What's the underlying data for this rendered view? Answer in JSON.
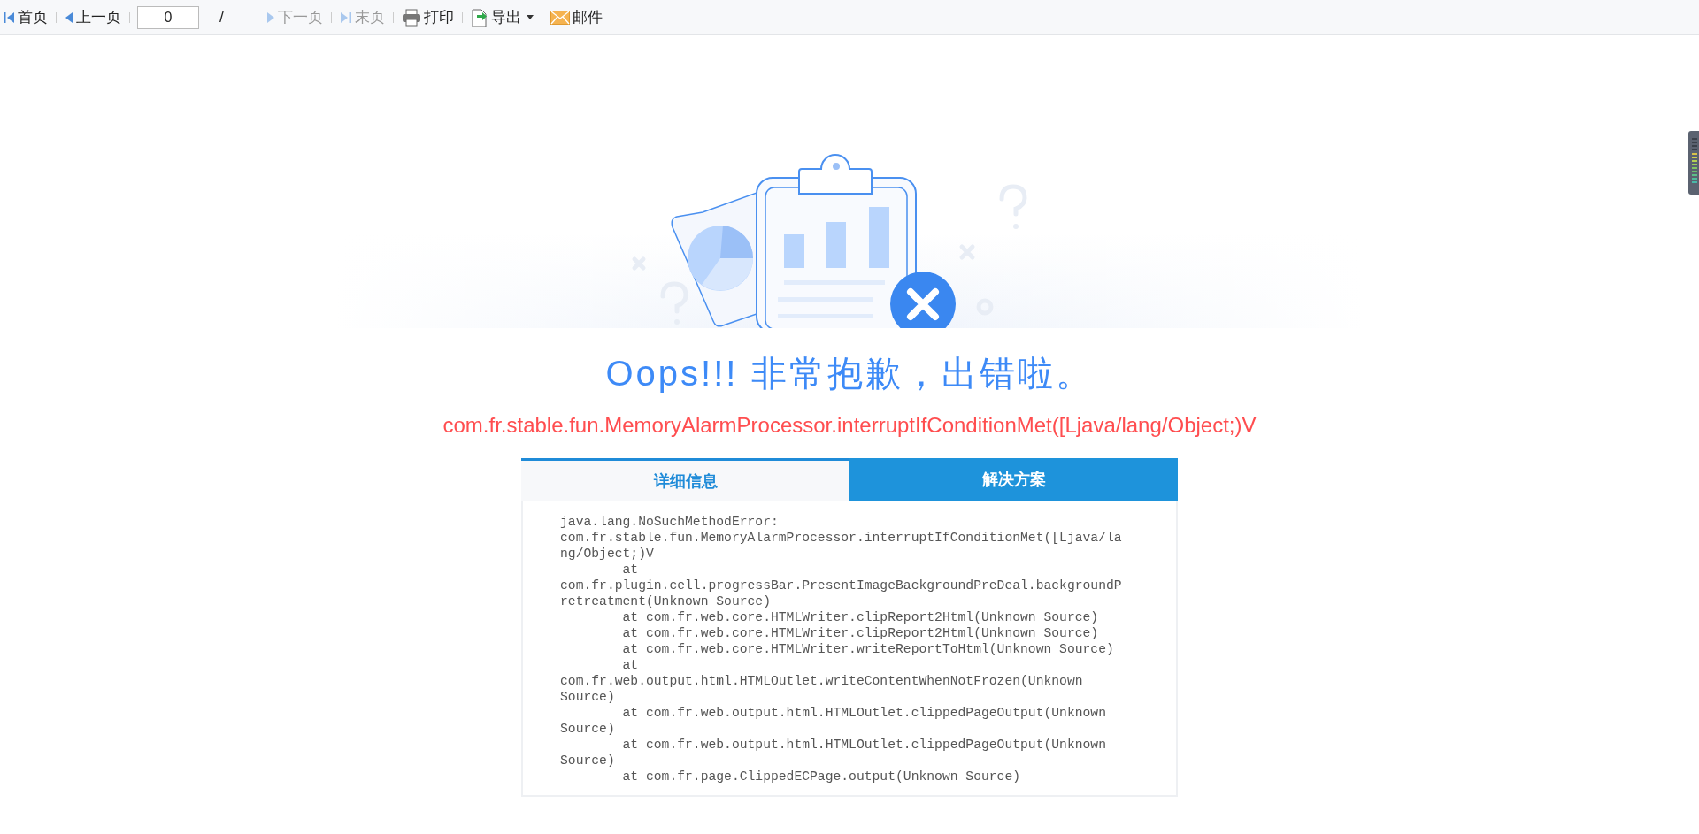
{
  "toolbar": {
    "items": [
      {
        "kind": "button",
        "label": "首页",
        "disabled": false
      },
      {
        "kind": "button",
        "label": "上一页",
        "disabled": false
      },
      {
        "kind": "page",
        "value": "0",
        "separator": "/"
      },
      {
        "kind": "button",
        "label": "下一页",
        "disabled": true
      },
      {
        "kind": "button",
        "label": "末页",
        "disabled": true
      },
      {
        "kind": "button",
        "label": "打印",
        "disabled": false
      },
      {
        "kind": "dropdown",
        "label": "导出",
        "disabled": false
      },
      {
        "kind": "button",
        "label": "邮件",
        "disabled": false
      }
    ]
  },
  "error": {
    "heading": "Oops!!! 非常抱歉，出错啦。",
    "message": "com.fr.stable.fun.MemoryAlarmProcessor.interruptIfConditionMet([Ljava/lang/Object;)V"
  },
  "tabs": [
    {
      "label": "详细信息",
      "selected": true
    },
    {
      "label": "解决方案",
      "selected": false
    }
  ],
  "details": {
    "lines": [
      "java.lang.NoSuchMethodError:",
      "com.fr.stable.fun.MemoryAlarmProcessor.interruptIfConditionMet([Ljava/la",
      "ng/Object;)V",
      "        at",
      "com.fr.plugin.cell.progressBar.PresentImageBackgroundPreDeal.backgroundP",
      "retreatment(Unknown Source)",
      "        at com.fr.web.core.HTMLWriter.clipReport2Html(Unknown Source)",
      "        at com.fr.web.core.HTMLWriter.clipReport2Html(Unknown Source)",
      "        at com.fr.web.core.HTMLWriter.writeReportToHtml(Unknown Source)",
      "        at",
      "com.fr.web.output.html.HTMLOutlet.writeContentWhenNotFrozen(Unknown",
      "Source)",
      "        at com.fr.web.output.html.HTMLOutlet.clippedPageOutput(Unknown",
      "Source)",
      "        at com.fr.web.output.html.HTMLOutlet.clippedPageOutput(Unknown",
      "Source)",
      "        at com.fr.page.ClippedECPage.output(Unknown Source)"
    ]
  }
}
